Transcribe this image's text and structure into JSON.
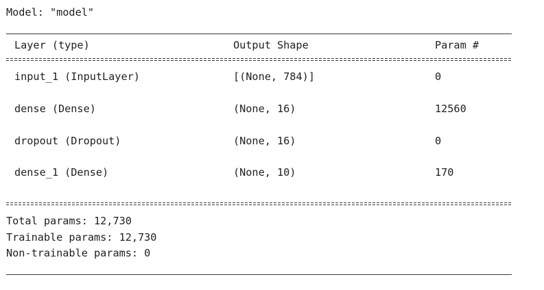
{
  "model_line": "Model: \"model\"",
  "header": {
    "layer_col": "Layer (type)",
    "shape_col": "Output Shape",
    "param_col": "Param #"
  },
  "rows": [
    {
      "layer": "input_1 (InputLayer)",
      "shape": "[(None, 784)]",
      "params": "0"
    },
    {
      "layer": "dense (Dense)",
      "shape": "(None, 16)",
      "params": "12560"
    },
    {
      "layer": "dropout (Dropout)",
      "shape": "(None, 16)",
      "params": "0"
    },
    {
      "layer": "dense_1 (Dense)",
      "shape": "(None, 10)",
      "params": "170"
    }
  ],
  "totals": {
    "total": "Total params: 12,730",
    "trainable": "Trainable params: 12,730",
    "non_trainable": "Non-trainable params: 0"
  }
}
